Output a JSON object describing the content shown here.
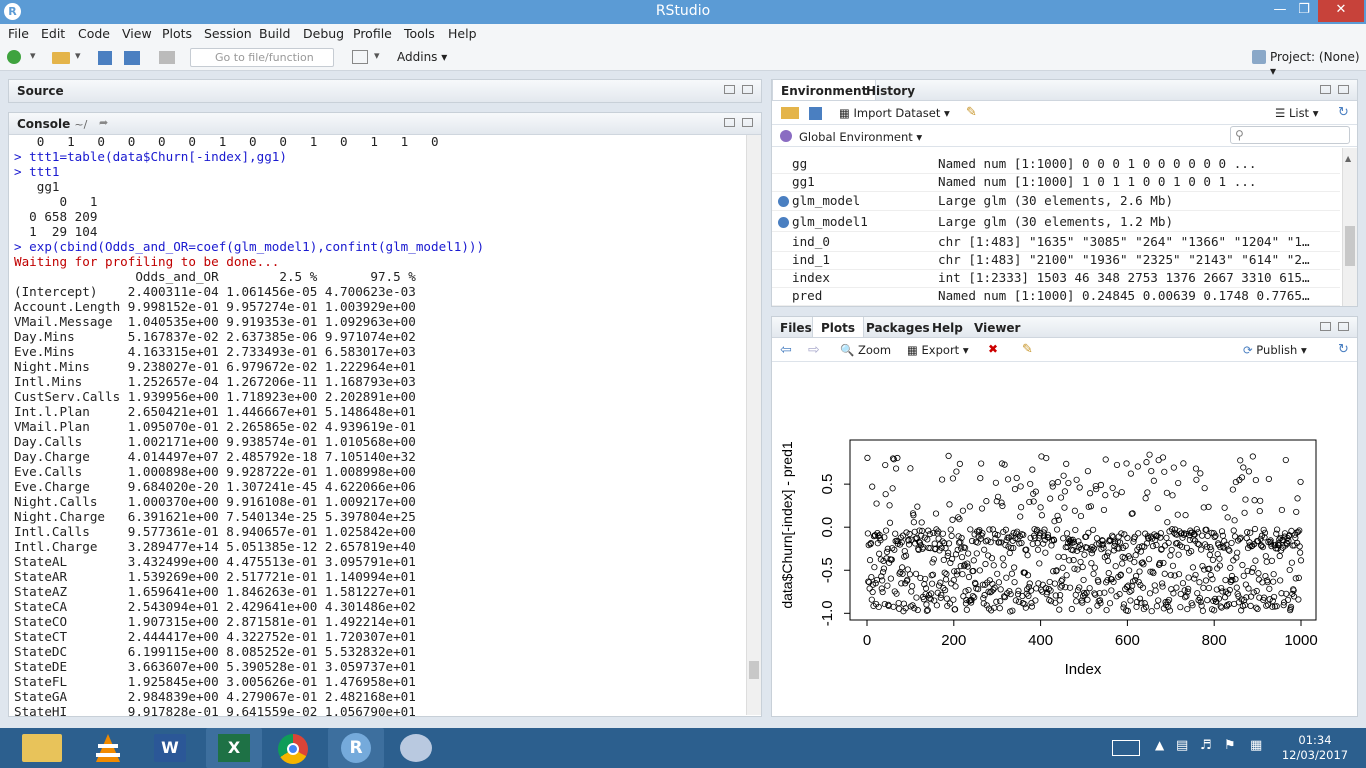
{
  "window": {
    "title": "RStudio"
  },
  "menu": [
    "File",
    "Edit",
    "Code",
    "View",
    "Plots",
    "Session",
    "Build",
    "Debug",
    "Profile",
    "Tools",
    "Help"
  ],
  "toolbar": {
    "goto_placeholder": "Go to file/function",
    "addins": "Addins",
    "project": "Project: (None)"
  },
  "source": {
    "title": "Source"
  },
  "console": {
    "title": "Console",
    "path": "~/",
    "lines": [
      {
        "c": "out",
        "t": "   0   1   0   0   0   0   1   0   0   1   0   1   1   0"
      },
      {
        "c": "cmd",
        "t": "> ttt1=table(data$Churn[-index],gg1)"
      },
      {
        "c": "cmd",
        "t": "> ttt1"
      },
      {
        "c": "out",
        "t": "   gg1"
      },
      {
        "c": "out",
        "t": "      0   1"
      },
      {
        "c": "out",
        "t": "  0 658 209"
      },
      {
        "c": "out",
        "t": "  1  29 104"
      },
      {
        "c": "cmd",
        "t": "> exp(cbind(Odds_and_OR=coef(glm_model1),confint(glm_model1)))"
      },
      {
        "c": "err",
        "t": "Waiting for profiling to be done..."
      },
      {
        "c": "out",
        "t": "                Odds_and_OR        2.5 %       97.5 %"
      },
      {
        "c": "out",
        "t": "(Intercept)    2.400311e-04 1.061456e-05 4.700623e-03"
      },
      {
        "c": "out",
        "t": "Account.Length 9.998152e-01 9.957274e-01 1.003929e+00"
      },
      {
        "c": "out",
        "t": "VMail.Message  1.040535e+00 9.919353e-01 1.092963e+00"
      },
      {
        "c": "out",
        "t": "Day.Mins       5.167837e-02 2.637385e-06 9.971074e+02"
      },
      {
        "c": "out",
        "t": "Eve.Mins       4.163315e+01 2.733493e-01 6.583017e+03"
      },
      {
        "c": "out",
        "t": "Night.Mins     9.238027e-01 6.979672e-02 1.222964e+01"
      },
      {
        "c": "out",
        "t": "Intl.Mins      1.252657e-04 1.267206e-11 1.168793e+03"
      },
      {
        "c": "out",
        "t": "CustServ.Calls 1.939956e+00 1.718923e+00 2.202891e+00"
      },
      {
        "c": "out",
        "t": "Int.l.Plan     2.650421e+01 1.446667e+01 5.148648e+01"
      },
      {
        "c": "out",
        "t": "VMail.Plan     1.095070e-01 2.265865e-02 4.939619e-01"
      },
      {
        "c": "out",
        "t": "Day.Calls      1.002171e+00 9.938574e-01 1.010568e+00"
      },
      {
        "c": "out",
        "t": "Day.Charge     4.014497e+07 2.485792e-18 7.105140e+32"
      },
      {
        "c": "out",
        "t": "Eve.Calls      1.000898e+00 9.928722e-01 1.008998e+00"
      },
      {
        "c": "out",
        "t": "Eve.Charge     9.684020e-20 1.307241e-45 4.622066e+06"
      },
      {
        "c": "out",
        "t": "Night.Calls    1.000370e+00 9.916108e-01 1.009217e+00"
      },
      {
        "c": "out",
        "t": "Night.Charge   6.391621e+00 7.540134e-25 5.397804e+25"
      },
      {
        "c": "out",
        "t": "Intl.Calls     9.577361e-01 8.940657e-01 1.025842e+00"
      },
      {
        "c": "out",
        "t": "Intl.Charge    3.289477e+14 5.051385e-12 2.657819e+40"
      },
      {
        "c": "out",
        "t": "StateAL        3.432499e+00 4.475513e-01 3.095791e+01"
      },
      {
        "c": "out",
        "t": "StateAR        1.539269e+00 2.517721e-01 1.140994e+01"
      },
      {
        "c": "out",
        "t": "StateAZ        1.659641e+00 1.846263e-01 1.581227e+01"
      },
      {
        "c": "out",
        "t": "StateCA        2.543094e+01 2.429641e+00 4.301486e+02"
      },
      {
        "c": "out",
        "t": "StateCO        1.907315e+00 2.871581e-01 1.492214e+01"
      },
      {
        "c": "out",
        "t": "StateCT        2.444417e+00 4.322752e-01 1.720307e+01"
      },
      {
        "c": "out",
        "t": "StateDC        6.199115e+00 8.085252e-01 5.532832e+01"
      },
      {
        "c": "out",
        "t": "StateDE        3.663607e+00 5.390528e-01 3.059737e+01"
      },
      {
        "c": "out",
        "t": "StateFL        1.925845e+00 3.005626e-01 1.476958e+01"
      },
      {
        "c": "out",
        "t": "StateGA        2.984839e+00 4.279067e-01 2.482168e+01"
      },
      {
        "c": "out",
        "t": "StateHI        9.917828e-01 9.641559e-02 1.056790e+01"
      }
    ]
  },
  "env": {
    "tabs": [
      "Environment",
      "History"
    ],
    "import": "Import Dataset",
    "list": "List",
    "scope": "Global Environment",
    "rows": [
      {
        "name": "gg",
        "value": "Named num [1:1000] 0 0 0 1 0 0 0 0 0 0 ...",
        "icon": false
      },
      {
        "name": "gg1",
        "value": "Named num [1:1000] 1 0 1 1 0 0 1 0 0 1 ...",
        "icon": false
      },
      {
        "name": "glm_model",
        "value": "Large glm (30 elements, 2.6 Mb)",
        "icon": true
      },
      {
        "name": "glm_model1",
        "value": "Large glm (30 elements, 1.2 Mb)",
        "icon": true
      },
      {
        "name": "ind_0",
        "value": "chr [1:483] \"1635\" \"3085\" \"264\" \"1366\" \"1204\" \"1…",
        "icon": false
      },
      {
        "name": "ind_1",
        "value": "chr [1:483] \"2100\" \"1936\" \"2325\" \"2143\" \"614\" \"2…",
        "icon": false
      },
      {
        "name": "index",
        "value": "int [1:2333] 1503 46 348 2753 1376 2667 3310 615…",
        "icon": false
      },
      {
        "name": "pred",
        "value": "Named num [1:1000] 0.24845 0.00639 0.1748 0.7765…",
        "icon": false
      }
    ]
  },
  "files": {
    "tabs": [
      "Files",
      "Plots",
      "Packages",
      "Help",
      "Viewer"
    ],
    "zoom": "Zoom",
    "export": "Export",
    "publish": "Publish"
  },
  "chart_data": {
    "type": "scatter",
    "xlabel": "Index",
    "ylabel": "data$Churn[-index] - pred1",
    "xticks": [
      "0",
      "200",
      "400",
      "600",
      "800",
      "1000"
    ],
    "yticks": [
      "-1.0",
      "-0.5",
      "0.0",
      "0.5"
    ],
    "xlim": [
      0,
      1000
    ],
    "ylim": [
      -1.0,
      0.9
    ],
    "n": 1000
  },
  "taskbar": {
    "time": "01:34",
    "date": "12/03/2017"
  }
}
